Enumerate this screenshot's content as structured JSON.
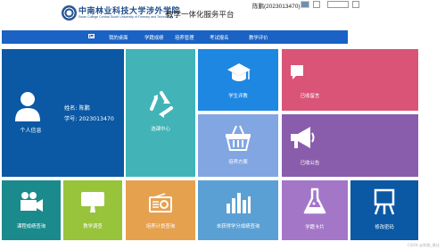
{
  "header": {
    "school_name_cn": "中南林业科技大学涉外学院",
    "school_name_en": "Swan College Central South University of Forestry and Technology",
    "platform_title": "教学一体化服务平台",
    "user_display": "陈鹏(2023013470)"
  },
  "nav": {
    "items": [
      {
        "label": "我的桌面"
      },
      {
        "label": "学籍成绩"
      },
      {
        "label": "培养管理"
      },
      {
        "label": "考试报名"
      },
      {
        "label": "教学评价"
      }
    ]
  },
  "profile": {
    "name_label": "姓名:",
    "name_value": "陈鹏",
    "id_label": "学号:",
    "id_value": "2023013470",
    "tile_label": "个人信息"
  },
  "tiles": {
    "elective": "选课中心",
    "eval": "学生评教",
    "messages": "已收留言",
    "plan": "培养方案",
    "notices": "已收公告",
    "grades": "课程成绩查询",
    "survey": "教学调查",
    "program_plan": "培养计划查询",
    "unfinished": "未获得学分成绩查询",
    "student_card": "学籍卡片",
    "change_password": "修改密码"
  },
  "watermark": "CSDN @陈鹏_最佳",
  "colors": {
    "nav": "#1a62c4",
    "profile": "#0b58a4",
    "elective": "#42b4b8",
    "eval": "#1d87e2",
    "messages": "#da5478",
    "plan": "#82a6e2",
    "notices": "#8a5dac",
    "grades": "#1b8a8c",
    "survey": "#97c43a",
    "program_plan": "#e6a14f",
    "unfinished": "#5ba0d4",
    "student_card": "#a376c8",
    "change_password": "#0b58a4"
  }
}
